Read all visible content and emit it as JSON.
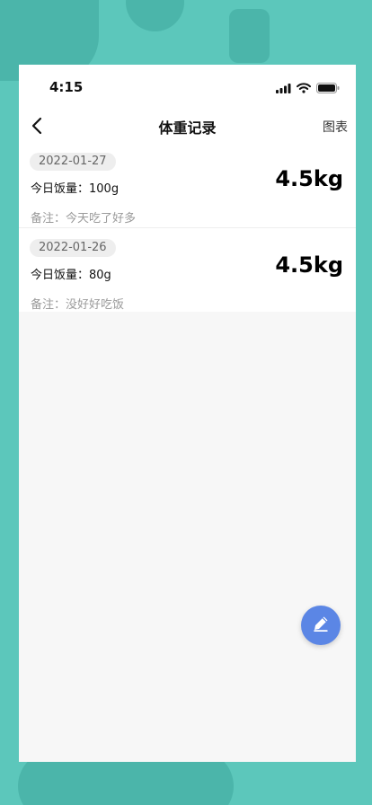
{
  "status_bar": {
    "time": "4:15"
  },
  "nav": {
    "title": "体重记录",
    "right_action": "图表"
  },
  "records": [
    {
      "date": "2022-01-27",
      "food": "今日饭量：100g",
      "note": "备注：今天吃了好多",
      "weight": "4.5kg"
    },
    {
      "date": "2022-01-26",
      "food": "今日饭量：80g",
      "note": "备注：没好好吃饭",
      "weight": "4.5kg"
    }
  ],
  "colors": {
    "background": "#5cc7bb",
    "fab": "#5b86e5"
  },
  "icons": {
    "back": "chevron-left-icon",
    "edit": "pencil-icon",
    "signal": "signal-icon",
    "wifi": "wifi-icon",
    "battery": "battery-icon"
  }
}
